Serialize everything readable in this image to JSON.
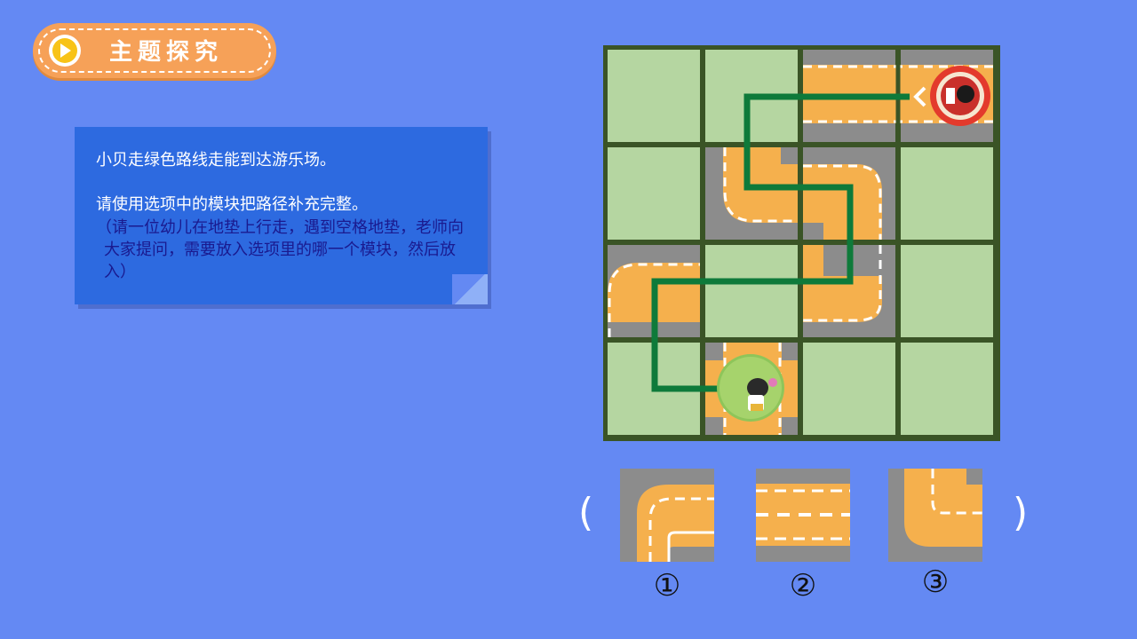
{
  "header": {
    "title": "主题探究",
    "icon": "play-icon"
  },
  "instructions": {
    "line1": "小贝走绿色路线走能到达游乐场。",
    "line2": "请使用选项中的模块把路径补充完整。",
    "line3": "（请一位幼儿在地垫上行走，遇到空格地垫，老师向大家提问，需要放入选项里的哪一个模块，然后放入）"
  },
  "options": {
    "open_paren": "(",
    "close_paren": ")",
    "labels": [
      "①",
      "②",
      "③"
    ]
  },
  "colors": {
    "background": "#6489f3",
    "road": "#f5b04d",
    "pavement": "#8c8c8c",
    "grass": "#b5d6a1",
    "path": "#0e7a3a",
    "card": "#2d6ae0",
    "pill": "#f6a158"
  },
  "board": {
    "rows": 4,
    "cols": 4,
    "start": "character-avatar",
    "goal": "amusement-park-badge"
  }
}
